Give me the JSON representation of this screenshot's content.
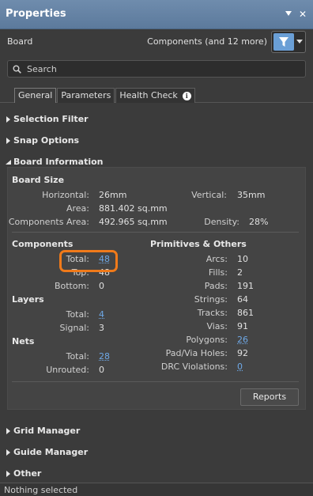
{
  "window": {
    "title": "Properties"
  },
  "header": {
    "object_type": "Board",
    "filter_summary": "Components (and 12 more)"
  },
  "search": {
    "placeholder": "Search"
  },
  "tabs": [
    {
      "label": "General",
      "active": true
    },
    {
      "label": "Parameters",
      "active": false
    },
    {
      "label": "Health Check",
      "active": false
    }
  ],
  "sections": {
    "selection_filter": "Selection Filter",
    "snap_options": "Snap Options",
    "board_information": "Board Information",
    "grid_manager": "Grid Manager",
    "guide_manager": "Guide Manager",
    "other": "Other"
  },
  "board_size": {
    "title": "Board Size",
    "horizontal_label": "Horizontal:",
    "horizontal": "26mm",
    "vertical_label": "Vertical:",
    "vertical": "35mm",
    "area_label": "Area:",
    "area": "881.402 sq.mm",
    "components_area_label": "Components Area:",
    "components_area": "492.965 sq.mm",
    "density_label": "Density:",
    "density": "28%"
  },
  "components": {
    "title": "Components",
    "total_label": "Total:",
    "total": "48",
    "top_label": "Top:",
    "top": "48",
    "bottom_label": "Bottom:",
    "bottom": "0"
  },
  "layers": {
    "title": "Layers",
    "total_label": "Total:",
    "total": "4",
    "signal_label": "Signal:",
    "signal": "3"
  },
  "nets": {
    "title": "Nets",
    "total_label": "Total:",
    "total": "28",
    "unrouted_label": "Unrouted:",
    "unrouted": "0"
  },
  "primitives": {
    "title": "Primitives & Others",
    "items": [
      {
        "label": "Arcs:",
        "value": "10",
        "link": false
      },
      {
        "label": "Fills:",
        "value": "2",
        "link": false
      },
      {
        "label": "Pads:",
        "value": "191",
        "link": false
      },
      {
        "label": "Strings:",
        "value": "64",
        "link": false
      },
      {
        "label": "Tracks:",
        "value": "861",
        "link": false
      },
      {
        "label": "Vias:",
        "value": "91",
        "link": false
      },
      {
        "label": "Polygons:",
        "value": "26",
        "link": true
      },
      {
        "label": "Pad/Via Holes:",
        "value": "92",
        "link": false
      },
      {
        "label": "DRC Violations:",
        "value": "0",
        "link": true
      }
    ]
  },
  "buttons": {
    "reports": "Reports"
  },
  "status": {
    "text": "Nothing selected"
  },
  "colors": {
    "highlight": "#f07a1a",
    "link": "#6ea8e6",
    "titlebar": "#6584a6",
    "filter_accent": "#6a9fd6"
  }
}
